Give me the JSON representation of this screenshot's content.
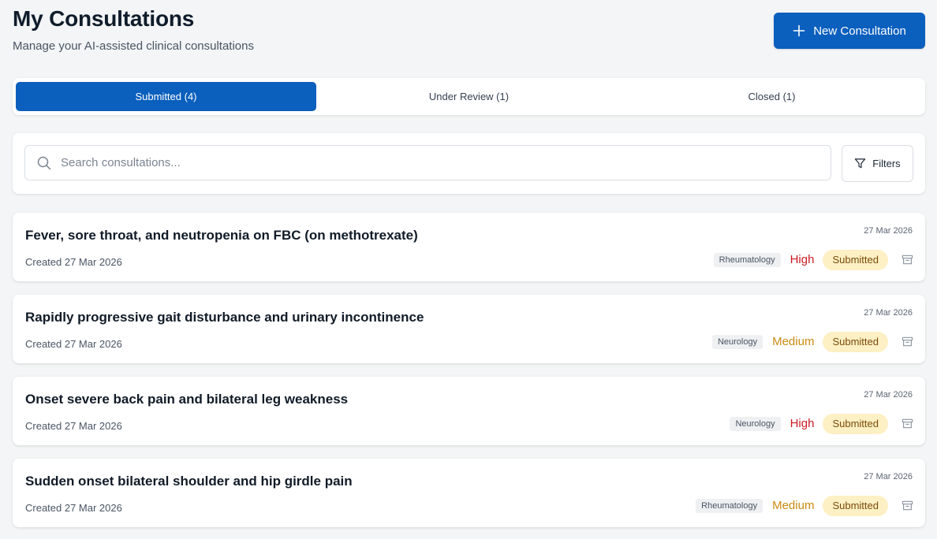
{
  "header": {
    "title": "My Consultations",
    "subtitle": "Manage your AI-assisted clinical consultations",
    "new_button_label": "New Consultation"
  },
  "tabs": [
    {
      "label": "Submitted (4)",
      "active": true
    },
    {
      "label": "Under Review (1)",
      "active": false
    },
    {
      "label": "Closed (1)",
      "active": false
    }
  ],
  "search": {
    "placeholder": "Search consultations...",
    "value": ""
  },
  "filters_label": "Filters",
  "colors": {
    "primary": "#0b5fbd",
    "high": "#cc1a22",
    "medium": "#c98a12",
    "status_bg": "#fdf0c4"
  },
  "consultations": [
    {
      "title": "Fever, sore throat, and neutropenia on FBC (on methotrexate)",
      "created": "Created 27 Mar 2026",
      "date": "27 Mar 2026",
      "specialty": "Rheumatology",
      "priority": "High",
      "status": "Submitted",
      "archive_icon": "archive-icon"
    },
    {
      "title": "Rapidly progressive gait disturbance and urinary incontinence",
      "created": "Created 27 Mar 2026",
      "date": "27 Mar 2026",
      "specialty": "Neurology",
      "priority": "Medium",
      "status": "Submitted",
      "archive_icon": "archive-icon"
    },
    {
      "title": "Onset severe back pain and bilateral leg weakness",
      "created": "Created 27 Mar 2026",
      "date": "27 Mar 2026",
      "specialty": "Neurology",
      "priority": "High",
      "status": "Submitted",
      "archive_icon": "archive-icon"
    },
    {
      "title": "Sudden onset bilateral shoulder and hip girdle pain",
      "created": "Created 27 Mar 2026",
      "date": "27 Mar 2026",
      "specialty": "Rheumatology",
      "priority": "Medium",
      "status": "Submitted",
      "archive_icon": "archive-icon"
    }
  ]
}
